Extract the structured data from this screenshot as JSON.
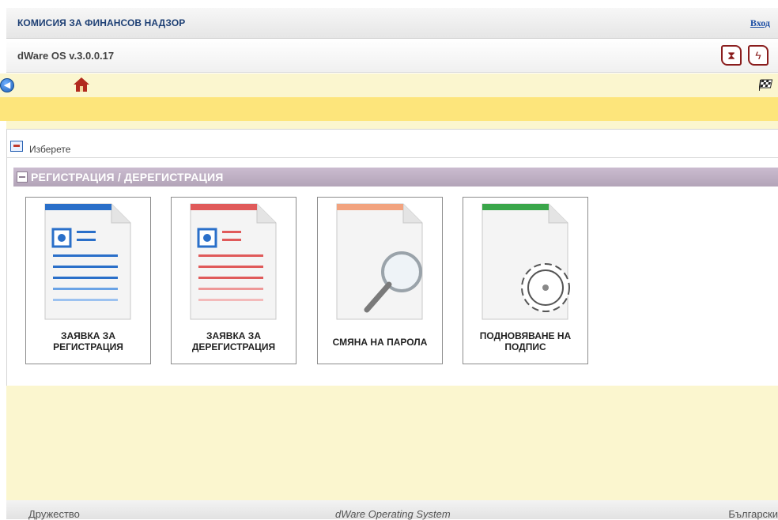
{
  "header": {
    "org_title": "КОМИСИЯ ЗА ФИНАНСОВ НАДЗОР",
    "login_label": "Вход",
    "version": "dWare OS v.3.0.0.17",
    "icons": [
      "hourglass-icon",
      "lightning-icon"
    ]
  },
  "toolbar": {
    "icons": [
      "back-icon",
      "home-icon",
      "checkered-flag-icon"
    ]
  },
  "panel": {
    "choose_label": "Изберете",
    "section_title": "РЕГИСТРАЦИЯ / ДЕРЕГИСТРАЦИЯ",
    "tiles": [
      {
        "label": "ЗАЯВКА ЗА РЕГИСТРАЦИЯ",
        "icon": "registration-document-icon",
        "accent": "#2a6fc9"
      },
      {
        "label": "ЗАЯВКА ЗА ДЕРЕГИСТРАЦИЯ",
        "icon": "deregistration-document-icon",
        "accent": "#e05a5a"
      },
      {
        "label": "СМЯНА НА ПАРОЛА",
        "icon": "password-search-icon",
        "accent": "#f2a37f"
      },
      {
        "label": "ПОДНОВЯВАНЕ НА ПОДПИС",
        "icon": "signature-settings-icon",
        "accent": "#3aa64a"
      }
    ]
  },
  "footer": {
    "left": "Дружество",
    "center": "dWare Operating System",
    "right": "Български"
  },
  "colors": {
    "toolbar_bg": "#fbf6cf",
    "message_bar": "#fde57b",
    "section_header": "#b3a4b8",
    "title_blue": "#1d3f74"
  }
}
